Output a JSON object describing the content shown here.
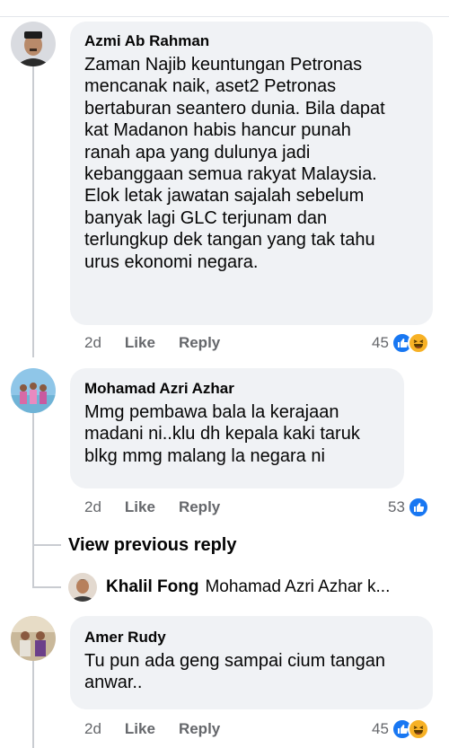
{
  "comments": [
    {
      "author": "Azmi Ab Rahman",
      "lines": [
        "Zaman Najib keuntungan Petronas",
        "mencanak naik, aset2 Petronas",
        "bertaburan seantero dunia. Bila dapat",
        "kat Madanon habis hancur punah",
        "ranah apa yang dulunya jadi",
        "kebanggaan semua rakyat Malaysia.",
        "Elok letak jawatan sajalah  sebelum",
        "banyak lagi GLC terjunam dan",
        "terlungkup dek tangan yang tak tahu",
        "urus ekonomi negara."
      ],
      "time": "2d",
      "like_label": "Like",
      "reply_label": "Reply",
      "reaction_count": "45",
      "reactions": [
        "like-reaction-icon",
        "haha-reaction-icon"
      ]
    },
    {
      "author": "Mohamad Azri Azhar",
      "lines": [
        "Mmg pembawa bala la kerajaan",
        "madani ni..klu dh kepala kaki taruk",
        "blkg mmg malang la negara ni"
      ],
      "time": "2d",
      "like_label": "Like",
      "reply_label": "Reply",
      "reaction_count": "53",
      "reactions": [
        "like-reaction-icon"
      ]
    },
    {
      "author": "Amer Rudy",
      "lines": [
        "Tu pun ada geng sampai cium tangan",
        "anwar.."
      ],
      "time": "2d",
      "like_label": "Like",
      "reply_label": "Reply",
      "reaction_count": "45",
      "reactions": [
        "like-reaction-icon",
        "haha-reaction-icon"
      ]
    }
  ],
  "view_previous_reply": "View previous reply",
  "reply_preview": {
    "author": "Khalil Fong",
    "snippet": "Mohamad Azri Azhar k..."
  },
  "colors": {
    "bubble": "#f0f2f5",
    "like_blue": "#1877f2",
    "haha_yellow": "#f7b125",
    "meta_gray": "#65676b"
  }
}
